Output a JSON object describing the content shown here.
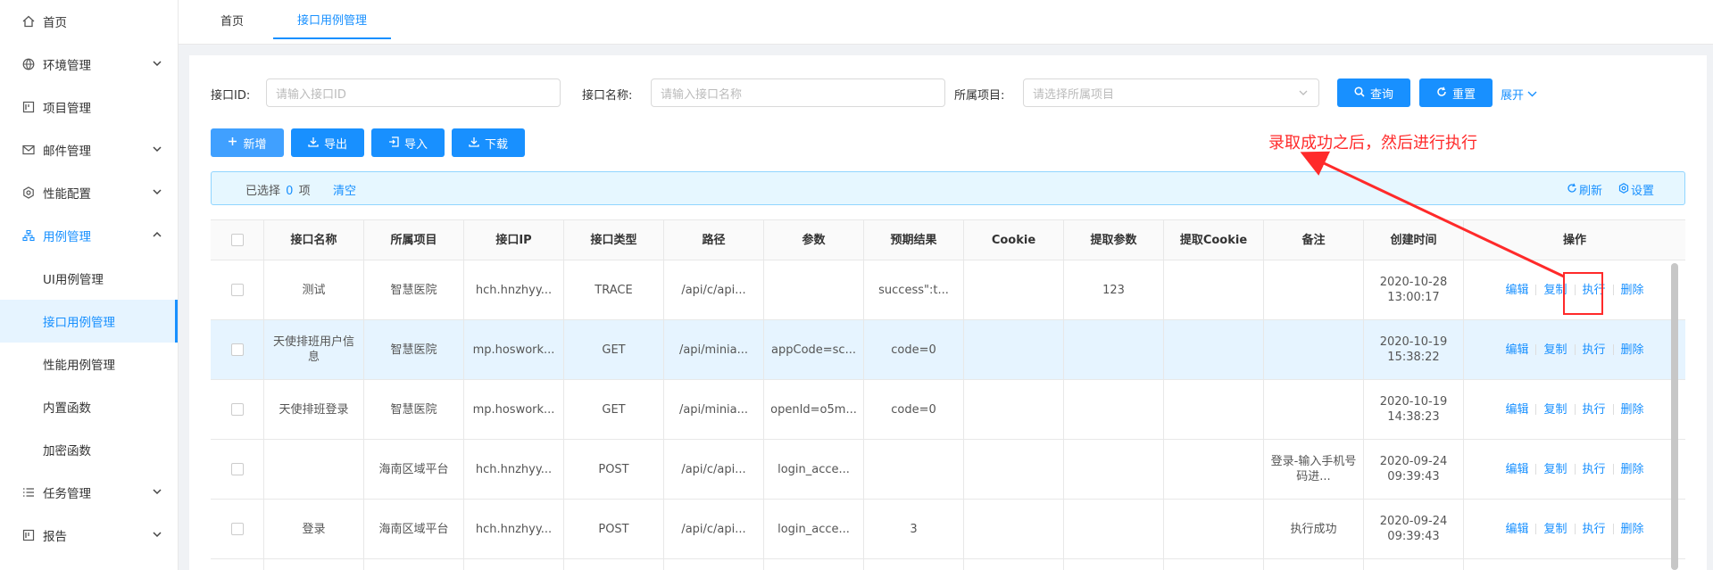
{
  "sidebar": {
    "items": [
      {
        "label": "首页",
        "icon": "home-icon"
      },
      {
        "label": "环境管理",
        "icon": "globe-icon"
      },
      {
        "label": "项目管理",
        "icon": "project-icon"
      },
      {
        "label": "邮件管理",
        "icon": "mail-icon"
      },
      {
        "label": "性能配置",
        "icon": "settings-icon"
      },
      {
        "label": "用例管理",
        "icon": "tree-icon"
      },
      {
        "label": "UI用例管理"
      },
      {
        "label": "接口用例管理"
      },
      {
        "label": "性能用例管理"
      },
      {
        "label": "内置函数"
      },
      {
        "label": "加密函数"
      },
      {
        "label": "任务管理",
        "icon": "list-icon"
      },
      {
        "label": "报告",
        "icon": "report-icon"
      }
    ]
  },
  "tabs": [
    {
      "label": "首页"
    },
    {
      "label": "接口用例管理"
    }
  ],
  "filters": {
    "id_label": "接口ID:",
    "id_placeholder": "请输入接口ID",
    "name_label": "接口名称:",
    "name_placeholder": "请输入接口名称",
    "project_label": "所属项目:",
    "project_placeholder": "请选择所属项目",
    "query_label": "查询",
    "reset_label": "重置",
    "expand_label": "展开"
  },
  "toolbar": {
    "add_label": "新增",
    "export_label": "导出",
    "import_label": "导入",
    "download_label": "下载"
  },
  "selection": {
    "prefix": "已选择",
    "count": "0",
    "suffix": "项",
    "clear_label": "清空",
    "refresh_label": "刷新",
    "settings_label": "设置"
  },
  "table": {
    "headers": [
      "接口名称",
      "所属项目",
      "接口IP",
      "接口类型",
      "路径",
      "参数",
      "预期结果",
      "Cookie",
      "提取参数",
      "提取Cookie",
      "备注",
      "创建时间",
      "操作"
    ],
    "rows": [
      {
        "name": "测试",
        "project": "智慧医院",
        "ip": "hch.hnzhyy...",
        "type": "TRACE",
        "path": "/api/c/api...",
        "params": "",
        "expected": "success\":t...",
        "cookie": "",
        "extract": "123",
        "extract_cookie": "",
        "remark": "",
        "created_date": "2020-10-28",
        "created_time": "13:00:17"
      },
      {
        "name": "天使排班用户信息",
        "project": "智慧医院",
        "ip": "mp.hoswork...",
        "type": "GET",
        "path": "/api/minia...",
        "params": "appCode=sc...",
        "expected": "code=0",
        "cookie": "",
        "extract": "",
        "extract_cookie": "",
        "remark": "",
        "created_date": "2020-10-19",
        "created_time": "15:38:22"
      },
      {
        "name": "天使排班登录",
        "project": "智慧医院",
        "ip": "mp.hoswork...",
        "type": "GET",
        "path": "/api/minia...",
        "params": "openId=o5m...",
        "expected": "code=0",
        "cookie": "",
        "extract": "",
        "extract_cookie": "",
        "remark": "",
        "created_date": "2020-10-19",
        "created_time": "14:38:23"
      },
      {
        "name": "",
        "project": "海南区域平台",
        "ip": "hch.hnzhyy...",
        "type": "POST",
        "path": "/api/c/api...",
        "params": "login_acce...",
        "expected": "",
        "cookie": "",
        "extract": "",
        "extract_cookie": "",
        "remark": "登录-输入手机号码进...",
        "created_date": "2020-09-24",
        "created_time": "09:39:43"
      },
      {
        "name": "登录",
        "project": "海南区域平台",
        "ip": "hch.hnzhyy...",
        "type": "POST",
        "path": "/api/c/api...",
        "params": "login_acce...",
        "expected": "3",
        "cookie": "",
        "extract": "",
        "extract_cookie": "",
        "remark": "执行成功",
        "created_date": "2020-09-24",
        "created_time": "09:39:43"
      }
    ],
    "ops": {
      "edit": "编辑",
      "copy": "复制",
      "run": "执行",
      "delete": "删除"
    }
  },
  "annotation": {
    "text": "录取成功之后，然后进行执行",
    "color": "#ff2a2a"
  },
  "colors": {
    "primary": "#1890ff",
    "highlight_row": "#e6f4ff"
  }
}
